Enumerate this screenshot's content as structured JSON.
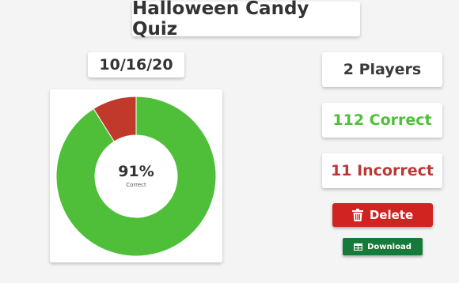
{
  "header": {
    "title": "Halloween Candy Quiz"
  },
  "quiz": {
    "date": "10/16/20"
  },
  "stats": {
    "players": "2 Players",
    "correct": "112 Correct",
    "incorrect": "11 Incorrect"
  },
  "donut": {
    "percent_label": "91%",
    "caption": "Correct"
  },
  "actions": {
    "delete_label": "Delete",
    "download_label": "Download"
  },
  "colors": {
    "correct": "#4fbf3a",
    "incorrect": "#c0392b",
    "delete_button": "#d12420",
    "download_button": "#157a3a"
  },
  "icons": {
    "delete": "trash-icon",
    "download": "table-icon"
  },
  "chart_data": {
    "type": "pie",
    "categories": [
      "Correct",
      "Incorrect"
    ],
    "values": [
      112,
      11
    ],
    "center_label": "91%",
    "center_caption": "Correct"
  }
}
